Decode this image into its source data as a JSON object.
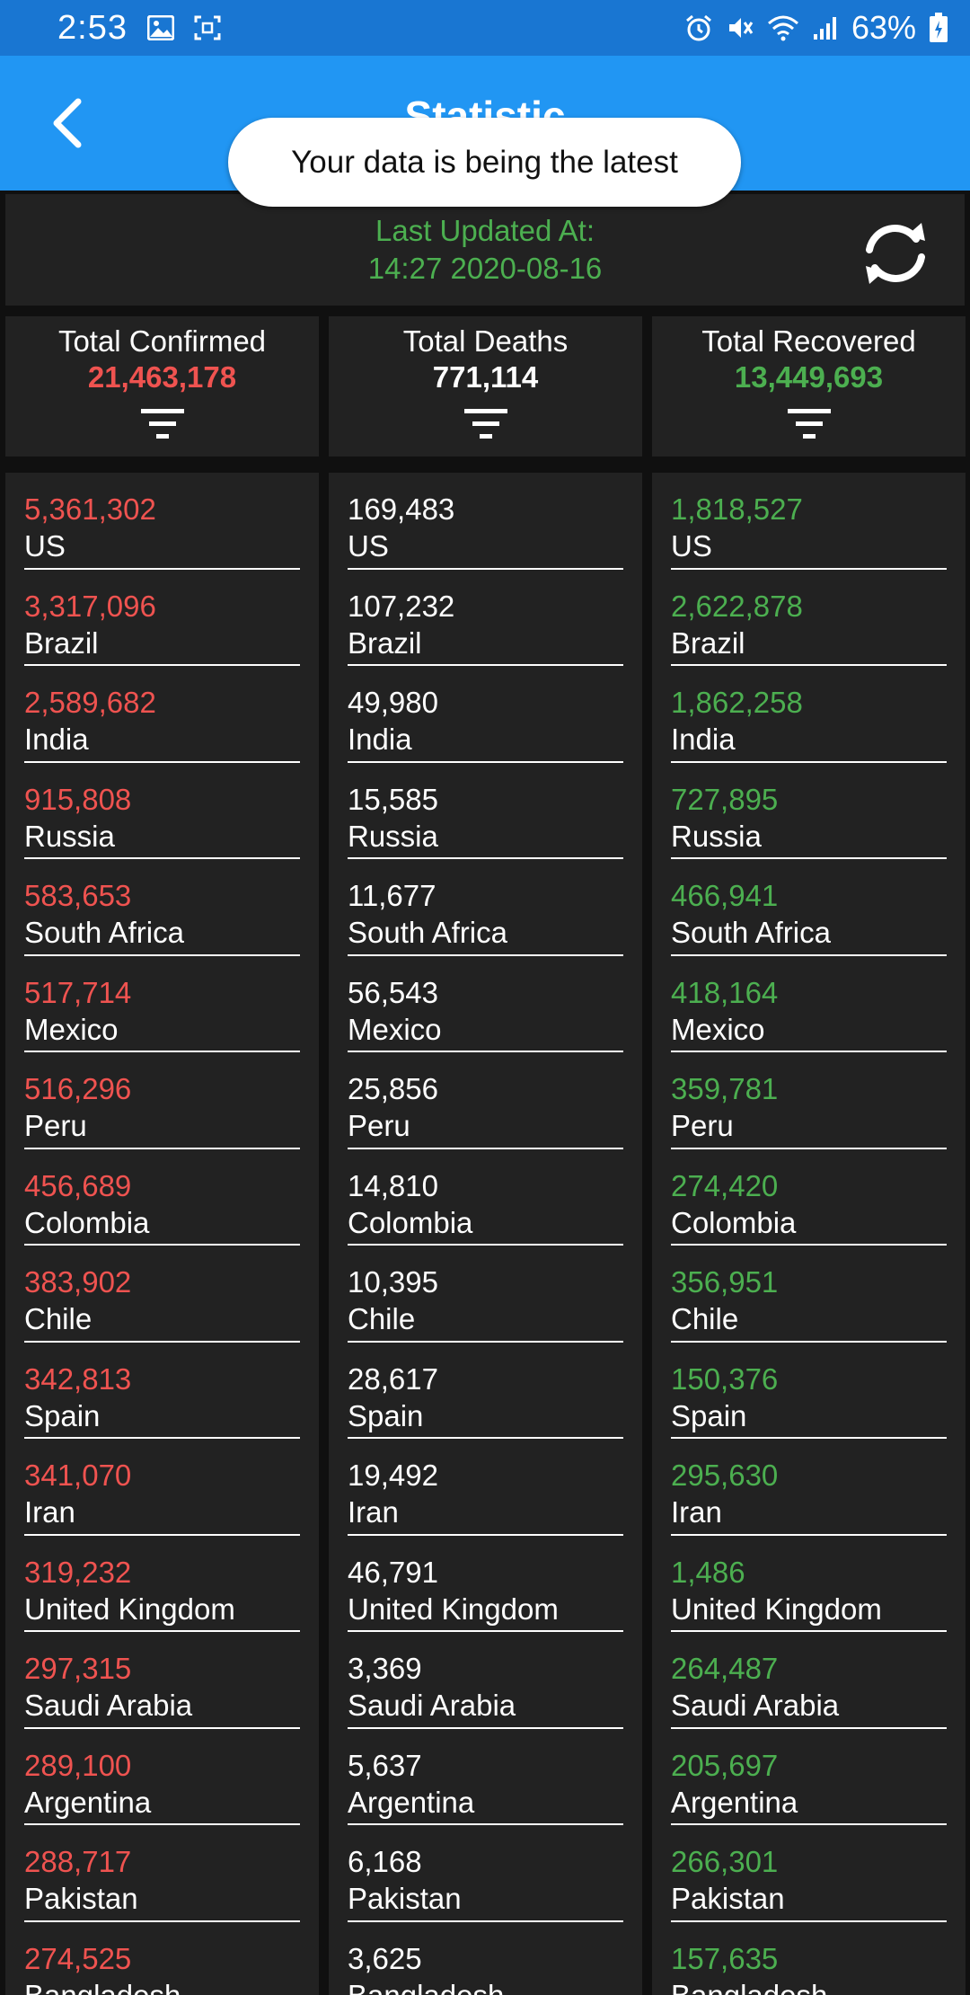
{
  "status_bar": {
    "time": "2:53",
    "battery": "63%",
    "icons": [
      "image-icon",
      "screenshot-icon",
      "alarm-icon",
      "mute-icon",
      "wifi-icon",
      "signal-icon",
      "battery-icon"
    ]
  },
  "appbar": {
    "title": "Statistic"
  },
  "toast": {
    "message": "Your data is being the latest"
  },
  "update": {
    "label": "Last Updated At:",
    "timestamp": "14:27 2020-08-16"
  },
  "totals": {
    "confirmed": {
      "label": "Total Confirmed",
      "value": "21,463,178",
      "color": "#EF5350"
    },
    "deaths": {
      "label": "Total Deaths",
      "value": "771,114",
      "color": "#FFFFFF"
    },
    "recovered": {
      "label": "Total Recovered",
      "value": "13,449,693",
      "color": "#4CAF50"
    }
  },
  "lists": {
    "confirmed": [
      {
        "value": "5,361,302",
        "country": "US"
      },
      {
        "value": "3,317,096",
        "country": "Brazil"
      },
      {
        "value": "2,589,682",
        "country": "India"
      },
      {
        "value": "915,808",
        "country": "Russia"
      },
      {
        "value": "583,653",
        "country": "South Africa"
      },
      {
        "value": "517,714",
        "country": "Mexico"
      },
      {
        "value": "516,296",
        "country": "Peru"
      },
      {
        "value": "456,689",
        "country": "Colombia"
      },
      {
        "value": "383,902",
        "country": "Chile"
      },
      {
        "value": "342,813",
        "country": "Spain"
      },
      {
        "value": "341,070",
        "country": "Iran"
      },
      {
        "value": "319,232",
        "country": "United Kingdom"
      },
      {
        "value": "297,315",
        "country": "Saudi Arabia"
      },
      {
        "value": "289,100",
        "country": "Argentina"
      },
      {
        "value": "288,717",
        "country": "Pakistan"
      },
      {
        "value": "274,525",
        "country": "Bangladesh"
      }
    ],
    "deaths": [
      {
        "value": "169,483",
        "country": "US"
      },
      {
        "value": "107,232",
        "country": "Brazil"
      },
      {
        "value": "49,980",
        "country": "India"
      },
      {
        "value": "15,585",
        "country": "Russia"
      },
      {
        "value": "11,677",
        "country": "South Africa"
      },
      {
        "value": "56,543",
        "country": "Mexico"
      },
      {
        "value": "25,856",
        "country": "Peru"
      },
      {
        "value": "14,810",
        "country": "Colombia"
      },
      {
        "value": "10,395",
        "country": "Chile"
      },
      {
        "value": "28,617",
        "country": "Spain"
      },
      {
        "value": "19,492",
        "country": "Iran"
      },
      {
        "value": "46,791",
        "country": "United Kingdom"
      },
      {
        "value": "3,369",
        "country": "Saudi Arabia"
      },
      {
        "value": "5,637",
        "country": "Argentina"
      },
      {
        "value": "6,168",
        "country": "Pakistan"
      },
      {
        "value": "3,625",
        "country": "Bangladesh"
      }
    ],
    "recovered": [
      {
        "value": "1,818,527",
        "country": "US"
      },
      {
        "value": "2,622,878",
        "country": "Brazil"
      },
      {
        "value": "1,862,258",
        "country": "India"
      },
      {
        "value": "727,895",
        "country": "Russia"
      },
      {
        "value": "466,941",
        "country": "South Africa"
      },
      {
        "value": "418,164",
        "country": "Mexico"
      },
      {
        "value": "359,781",
        "country": "Peru"
      },
      {
        "value": "274,420",
        "country": "Colombia"
      },
      {
        "value": "356,951",
        "country": "Chile"
      },
      {
        "value": "150,376",
        "country": "Spain"
      },
      {
        "value": "295,630",
        "country": "Iran"
      },
      {
        "value": "1,486",
        "country": "United Kingdom"
      },
      {
        "value": "264,487",
        "country": "Saudi Arabia"
      },
      {
        "value": "205,697",
        "country": "Argentina"
      },
      {
        "value": "266,301",
        "country": "Pakistan"
      },
      {
        "value": "157,635",
        "country": "Bangladesh"
      }
    ]
  },
  "colors": {
    "appbar": "#2196F3",
    "statusbar": "#1976D2",
    "card": "#222222",
    "confirmed": "#EF5350",
    "recovered": "#4CAF50"
  }
}
